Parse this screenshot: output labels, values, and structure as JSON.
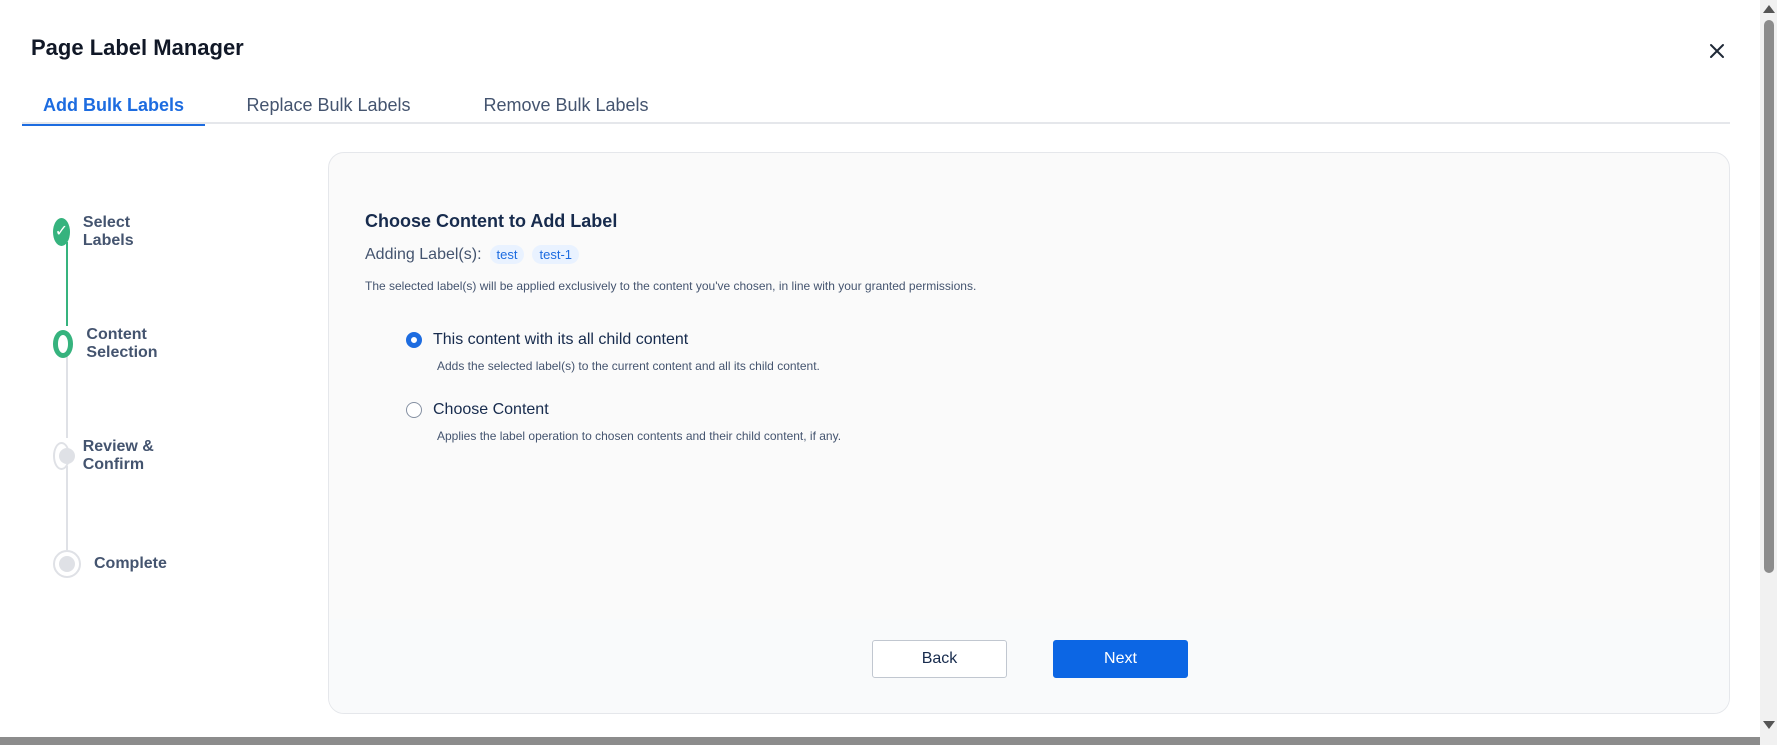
{
  "header": {
    "title": "Page Label Manager",
    "close_icon": "close-icon"
  },
  "tabs": [
    {
      "label": "Add Bulk Labels",
      "active": true
    },
    {
      "label": "Replace Bulk Labels",
      "active": false
    },
    {
      "label": "Remove Bulk Labels",
      "active": false
    }
  ],
  "stepper": {
    "steps": [
      {
        "label": "Select Labels",
        "state": "done"
      },
      {
        "label": "Content Selection",
        "state": "current"
      },
      {
        "label": "Review & Confirm",
        "state": "pending"
      },
      {
        "label": "Complete",
        "state": "pending"
      }
    ],
    "check_glyph": "✓"
  },
  "main": {
    "title": "Choose Content to Add Label",
    "labels_prefix": "Adding Label(s):",
    "labels": [
      "test",
      "test-1"
    ],
    "description": "The selected label(s) will be applied exclusively to the content you've chosen, in line with your granted permissions.",
    "options": [
      {
        "label": "This content with its all child content",
        "description": "Adds the selected label(s) to the current content and all its child content.",
        "checked": true
      },
      {
        "label": "Choose Content",
        "description": "Applies the label operation to chosen contents and their child content, if any.",
        "checked": false
      }
    ],
    "back_label": "Back",
    "next_label": "Next"
  },
  "colors": {
    "accent": "#1d6ce0",
    "primary_button": "#0c66e4",
    "success": "#36b37e"
  }
}
